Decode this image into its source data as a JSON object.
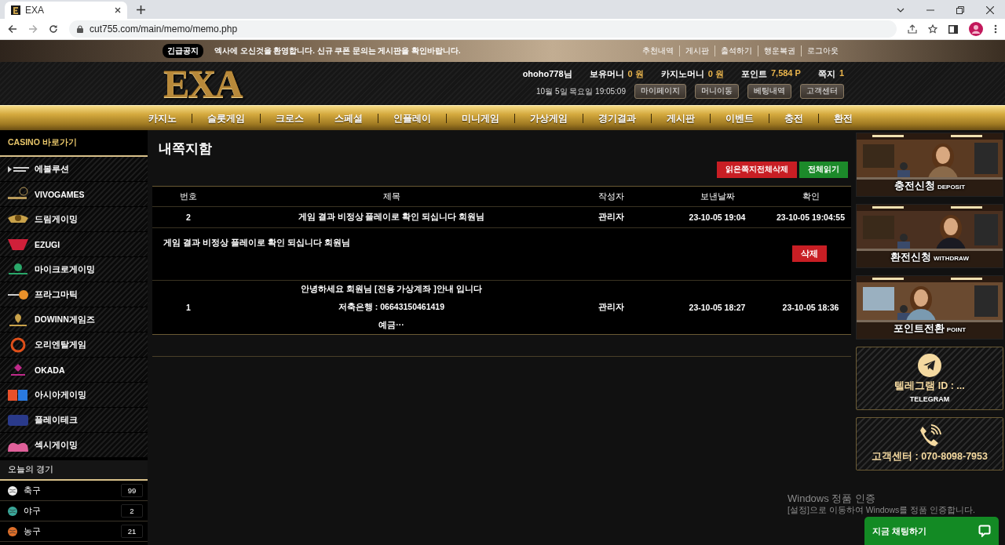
{
  "browser": {
    "tab_title": "EXA",
    "url": "cut755.com/main/memo/memo.php"
  },
  "notice": {
    "badge": "긴급공지",
    "text": "엑사에 오신것을 환영합니다. 신규 쿠폰 문의는 게시판을 확인바랍니다.",
    "links": [
      "추천내역",
      "게시판",
      "출석하기",
      "행운복권",
      "로그아웃"
    ]
  },
  "header": {
    "logo": "EXA",
    "user": "**ohoho778**님",
    "balances": [
      {
        "label": "보유머니",
        "value": "0 원"
      },
      {
        "label": "카지노머니",
        "value": "0 원"
      },
      {
        "label": "포인트",
        "value": "7,584 P"
      },
      {
        "label": "쪽지",
        "value": "1"
      }
    ],
    "datetime": "10월 5일 목요일 19:05:09",
    "buttons": [
      "마이페이지",
      "머니이동",
      "베팅내역",
      "고객센터"
    ]
  },
  "nav": [
    "카지노",
    "슬롯게임",
    "크로스",
    "스페셜",
    "인플레이",
    "미니게임",
    "가상게임",
    "경기결과",
    "게시판",
    "이벤트",
    "충전",
    "환전"
  ],
  "sidebar": {
    "casino_title": "CASINO 바로가기",
    "casino": [
      {
        "label": "에볼루션",
        "color": "#cfcfcf"
      },
      {
        "label": "VIVOGAMES",
        "color": "#b89a5a"
      },
      {
        "label": "드림게이밍",
        "color": "#c9a24a"
      },
      {
        "label": "EZUGI",
        "color": "#d0203a"
      },
      {
        "label": "마이크로게이밍",
        "color": "#2aa86a"
      },
      {
        "label": "프라그마틱",
        "color": "#e8902a"
      },
      {
        "label": "DOWINN게임즈",
        "color": "#c9a24a"
      },
      {
        "label": "오리엔탈게임",
        "color": "#e0501a"
      },
      {
        "label": "OKADA",
        "color": "#c02a8a"
      },
      {
        "label": "아시아게이밍",
        "color": "#2a7ae0"
      },
      {
        "label": "플레이테크",
        "color": "#2a3a8a"
      },
      {
        "label": "섹시게이밍",
        "color": "#e0609a"
      }
    ],
    "sports_title": "오늘의 경기",
    "sports": [
      {
        "label": "축구",
        "count": "99",
        "color": "#f0f0f0"
      },
      {
        "label": "야구",
        "count": "2",
        "color": "#3aa89a"
      },
      {
        "label": "농구",
        "count": "21",
        "color": "#e0702a"
      }
    ]
  },
  "memo": {
    "title": "내쪽지함",
    "actions": [
      {
        "label": "읽은쪽지전체삭제",
        "kind": "danger"
      },
      {
        "label": "전체읽기",
        "kind": "confirm"
      }
    ],
    "columns": [
      "번호",
      "제목",
      "작성자",
      "보낸날짜",
      "확인"
    ],
    "rows": [
      {
        "number": "2",
        "title_lines": [
          "게임 결과 비정상 플레이로 확인 되십니다 회원님"
        ],
        "author": "관리자",
        "sent": "23-10-05 19:04",
        "read": "23-10-05 19:04:55",
        "expanded": true,
        "body": "게임 결과 비정상 플레이로 확인 되십니다 회원님",
        "delete_label": "삭제"
      },
      {
        "number": "1",
        "title_lines": [
          "안녕하세요 회원님 [전용 가상계좌 ]안내 입니다",
          "저축은행 : 06643150461419",
          "예금···"
        ],
        "author": "관리자",
        "sent": "23-10-05 18:27",
        "read": "23-10-05 18:36",
        "expanded": false
      }
    ]
  },
  "rail": [
    {
      "kind": "picture",
      "label": "충전신청",
      "sub": "DEPOSIT"
    },
    {
      "kind": "picture",
      "label": "환전신청",
      "sub": "WITHDRAW"
    },
    {
      "kind": "picture",
      "label": "포인트전환",
      "sub": "POINT"
    },
    {
      "kind": "telegram",
      "label": "텔레그램 ID : ...",
      "sub": "TELEGRAM"
    },
    {
      "kind": "phone",
      "label": "고객센터 : 070-8098-7953"
    }
  ],
  "chat": {
    "label": "지금 채팅하기"
  },
  "windows_notice": {
    "title": "Windows 정품 인증",
    "text": "[설정]으로 이동하여 Windows를 정품 인증합니다."
  }
}
